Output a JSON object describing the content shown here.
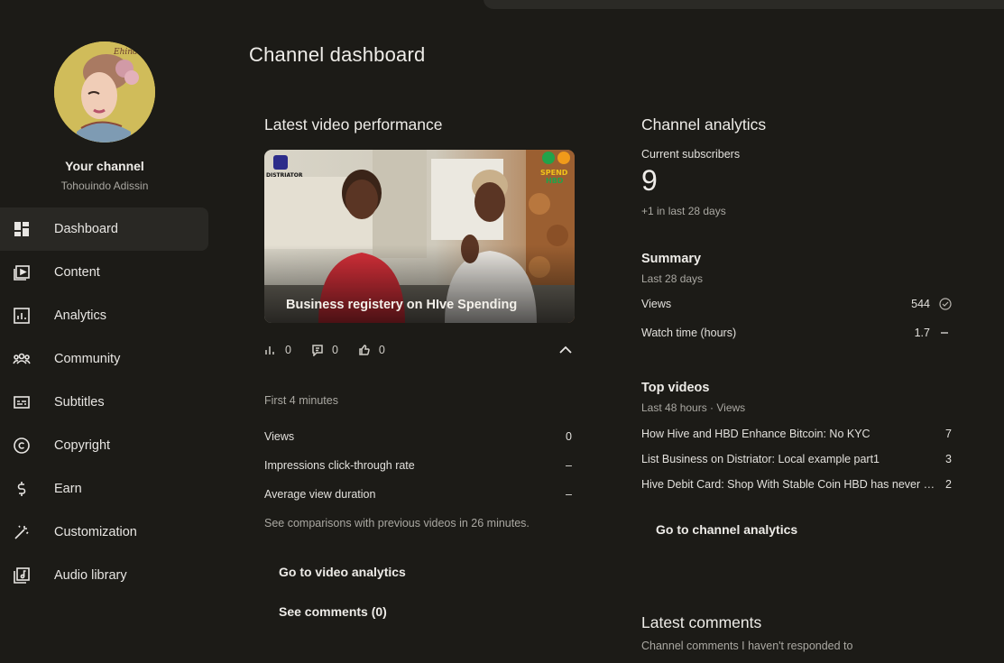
{
  "sidebar": {
    "channel_name": "Your channel",
    "handle": "Tohouindo Adissin",
    "items": [
      {
        "label": "Dashboard",
        "icon": "dashboard-icon",
        "active": true
      },
      {
        "label": "Content",
        "icon": "content-icon"
      },
      {
        "label": "Analytics",
        "icon": "analytics-icon"
      },
      {
        "label": "Community",
        "icon": "community-icon"
      },
      {
        "label": "Subtitles",
        "icon": "subtitles-icon"
      },
      {
        "label": "Copyright",
        "icon": "copyright-icon"
      },
      {
        "label": "Earn",
        "icon": "earn-icon"
      },
      {
        "label": "Customization",
        "icon": "customization-icon"
      },
      {
        "label": "Audio library",
        "icon": "audio-library-icon"
      }
    ]
  },
  "page": {
    "title": "Channel dashboard"
  },
  "latest_video": {
    "card_title": "Latest video performance",
    "video_title": "Business registery on HIve Spending",
    "thumbnail_labels": [
      "DISTRIATOR",
      "SPEND",
      "HBD"
    ],
    "stats": {
      "views": "0",
      "comments": "0",
      "likes": "0"
    },
    "period_label": "First 4 minutes",
    "metrics": [
      {
        "label": "Views",
        "value": "0"
      },
      {
        "label": "Impressions click-through rate",
        "value": "–"
      },
      {
        "label": "Average view duration",
        "value": "–"
      }
    ],
    "note": "See comparisons with previous videos in 26 minutes.",
    "analytics_button": "Go to video analytics",
    "comments_button": "See comments (0)"
  },
  "channel_analytics": {
    "card_title": "Channel analytics",
    "subscribers_label": "Current subscribers",
    "subscribers_count": "9",
    "subscribers_change": "+1 in last 28 days",
    "summary": {
      "title": "Summary",
      "period": "Last 28 days",
      "rows": [
        {
          "label": "Views",
          "value": "544",
          "indicator": "check-circle-icon"
        },
        {
          "label": "Watch time (hours)",
          "value": "1.7",
          "indicator": "dash-icon"
        }
      ]
    },
    "top_videos": {
      "title": "Top videos",
      "period": "Last 48 hours · Views",
      "rows": [
        {
          "title": "How Hive and HBD Enhance Bitcoin: No KYC",
          "views": "7"
        },
        {
          "title": "List Business on Distriator: Local example part1",
          "views": "3"
        },
        {
          "title": "Hive Debit Card: Shop With Stable Coin HBD has never been",
          "views": "2"
        }
      ]
    },
    "button": "Go to channel analytics"
  },
  "latest_comments": {
    "title": "Latest comments",
    "hint": "Channel comments I haven't responded to"
  },
  "colors": {
    "background": "#1c1b17",
    "active_nav": "#292824",
    "text_primary": "#eeece8",
    "text_secondary": "#aaa8a2"
  }
}
